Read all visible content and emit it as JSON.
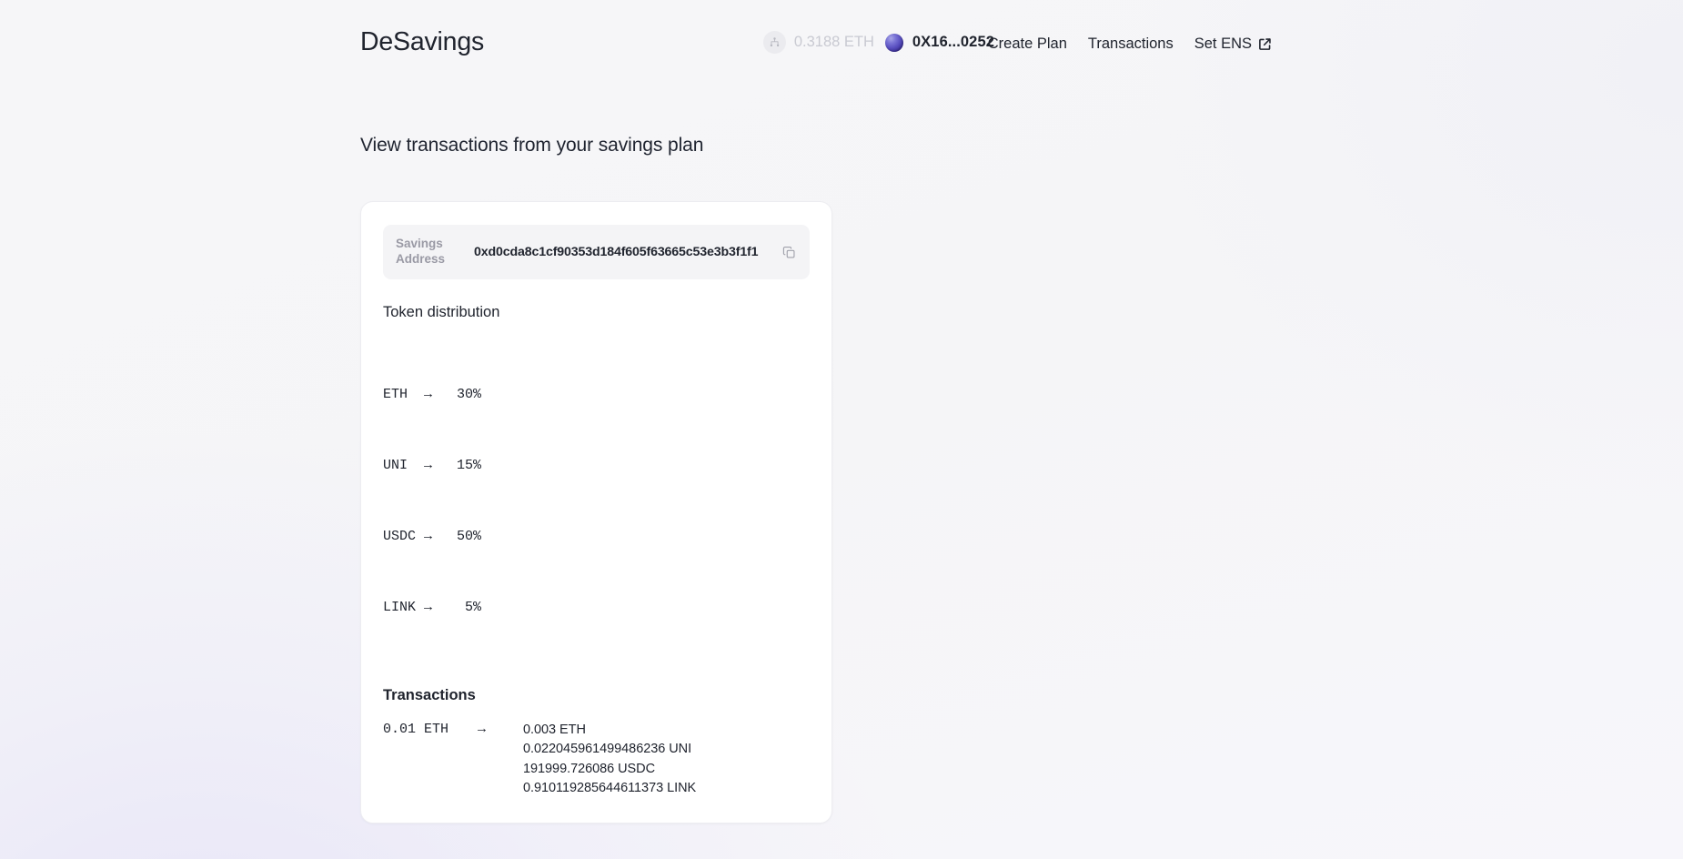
{
  "brand": {
    "name": "DeSavings"
  },
  "nav": {
    "items": [
      {
        "label": "Create Plan",
        "icon": "",
        "name": "nav-create-plan"
      },
      {
        "label": "Transactions",
        "icon": "",
        "name": "nav-transactions"
      },
      {
        "label": "Set ENS",
        "icon": "external-link-icon",
        "name": "nav-set-ens"
      }
    ]
  },
  "wallet": {
    "network_icon": "network-nodes-icon",
    "balance": "0.3188 ETH",
    "balance_color": "#c9cad2",
    "avatar_icon": "wallet-avatar-icon",
    "account": "0X16...0252",
    "avatar_colors": {
      "highlight": "#a8a5e6",
      "mid": "#5a50c0",
      "shadow": "#2e2480"
    }
  },
  "main": {
    "title": "View transactions from your savings plan"
  },
  "plan_card": {
    "address": {
      "label": "Savings Address",
      "value": "0xd0cda8c1cf90353d184f605f63665c53e3b3f1f1",
      "copy_icon": "copy-icon"
    },
    "distribution": {
      "heading": "Token distribution",
      "rows": [
        {
          "symbol": "ETH",
          "arrow": "→",
          "percent": "30%",
          "line": "ETH  →   30%"
        },
        {
          "symbol": "UNI",
          "arrow": "→",
          "percent": "15%",
          "line": "UNI  →   15%"
        },
        {
          "symbol": "USDC",
          "arrow": "→",
          "percent": "50%",
          "line": "USDC →   50%"
        },
        {
          "symbol": "LINK",
          "arrow": "→",
          "percent": "5%",
          "line": "LINK →    5%"
        }
      ]
    },
    "transactions": {
      "heading": "Transactions",
      "rows": [
        {
          "input": "0.01 ETH",
          "arrow": "→",
          "outputs": [
            "0.003 ETH",
            "0.022045961499486236 UNI",
            "191999.726086 USDC",
            "0.910119285644611373 LINK"
          ]
        }
      ]
    }
  },
  "theme": {
    "page_background": "#f6f6f8",
    "card_background": "#ffffff",
    "card_border": "#ededf1",
    "subcard_background": "#f4f4f6",
    "text_primary": "#20242e",
    "text_muted": "#9a9aa5"
  }
}
